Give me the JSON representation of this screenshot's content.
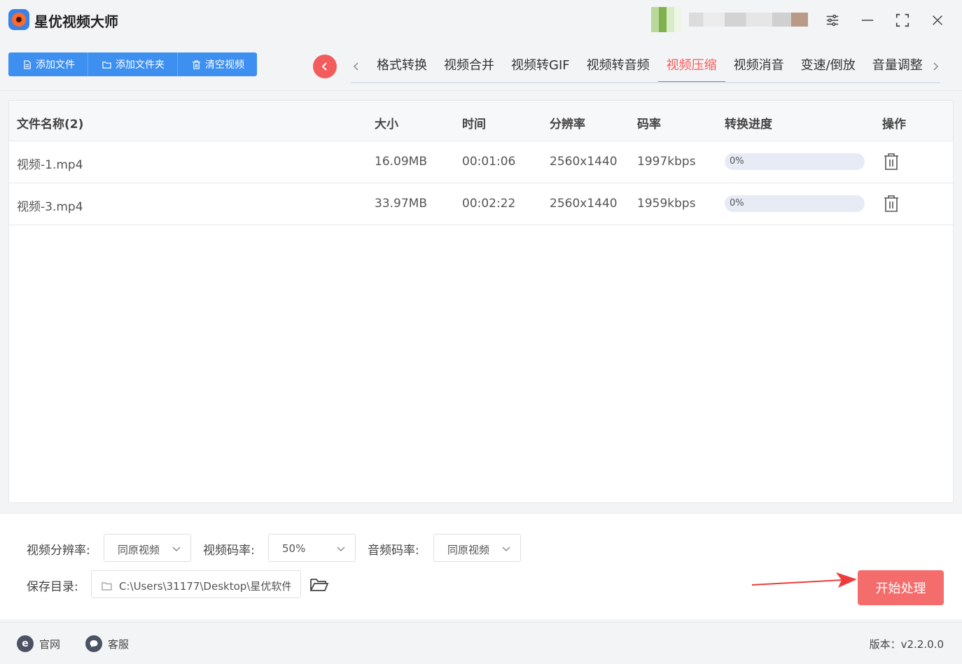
{
  "app": {
    "title": "星优视频大师"
  },
  "toolbar": {
    "add_file": "添加文件",
    "add_folder": "添加文件夹",
    "clear_videos": "清空视频"
  },
  "tabs": [
    {
      "label": "格式转换",
      "active": false
    },
    {
      "label": "视频合并",
      "active": false
    },
    {
      "label": "视频转GIF",
      "active": false
    },
    {
      "label": "视频转音频",
      "active": false
    },
    {
      "label": "视频压缩",
      "active": true
    },
    {
      "label": "视频消音",
      "active": false
    },
    {
      "label": "变速/倒放",
      "active": false
    },
    {
      "label": "音量调整",
      "active": false
    }
  ],
  "table": {
    "headers": {
      "name": "文件名称(2)",
      "size": "大小",
      "time": "时间",
      "resolution": "分辨率",
      "bitrate": "码率",
      "progress": "转换进度",
      "action": "操作"
    },
    "rows": [
      {
        "name": "视频-1.mp4",
        "size": "16.09MB",
        "time": "00:01:06",
        "resolution": "2560x1440",
        "bitrate": "1997kbps",
        "progress_text": "0%",
        "progress": 0
      },
      {
        "name": "视频-3.mp4",
        "size": "33.97MB",
        "time": "00:02:22",
        "resolution": "2560x1440",
        "bitrate": "1959kbps",
        "progress_text": "0%",
        "progress": 0
      }
    ]
  },
  "settings": {
    "video_resolution_label": "视频分辨率:",
    "video_resolution_value": "同原视频",
    "video_bitrate_label": "视频码率:",
    "video_bitrate_value": "50%",
    "audio_bitrate_label": "音频码率:",
    "audio_bitrate_value": "同原视频",
    "save_dir_label": "保存目录:",
    "save_dir_value": "C:\\Users\\31177\\Desktop\\星优软件",
    "start_button": "开始处理"
  },
  "footer": {
    "website": "官网",
    "support": "客服",
    "version": "版本：v2.2.0.0"
  },
  "colors": {
    "primary_blue": "#3d8ff0",
    "accent_red": "#f25c5c",
    "start_button": "#f56c6c"
  }
}
